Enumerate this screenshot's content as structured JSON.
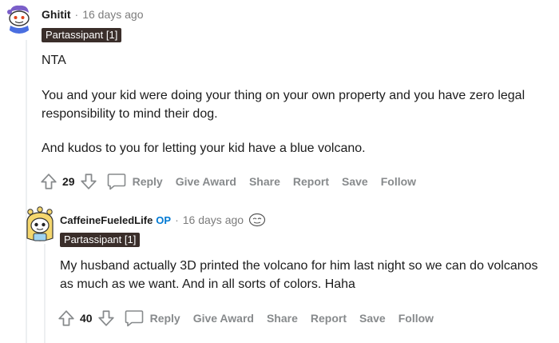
{
  "comment1": {
    "author": "Ghitit",
    "time": "16 days ago",
    "flair": "Partassipant [1]",
    "paragraphs": [
      "NTA",
      "You and your kid were doing your thing on your own property and you have zero legal responsibility to mind their dog.",
      "And kudos to you for letting your kid have a blue volcano."
    ],
    "score": "29",
    "actions": {
      "reply": "Reply",
      "give_award": "Give Award",
      "share": "Share",
      "report": "Report",
      "save": "Save",
      "follow": "Follow"
    }
  },
  "comment2": {
    "author": "CaffeineFueledLife",
    "op_badge": "OP",
    "time": "16 days ago",
    "flair": "Partassipant [1]",
    "paragraphs": [
      "My husband actually 3D printed the volcano for him last night so we can do volcanos as much as we want. And in all sorts of colors. Haha"
    ],
    "score": "40",
    "actions": {
      "reply": "Reply",
      "give_award": "Give Award",
      "share": "Share",
      "report": "Report",
      "save": "Save",
      "follow": "Follow"
    }
  },
  "icons": [
    "avatar-snoo-icon",
    "upvote-icon",
    "downvote-icon",
    "comment-bubble-icon",
    "award-emoji-icon"
  ],
  "colors": {
    "flair_bg": "#3a2e2a",
    "op_blue": "#0079d3",
    "muted": "#878a8c",
    "thread_line": "#edeff1"
  }
}
